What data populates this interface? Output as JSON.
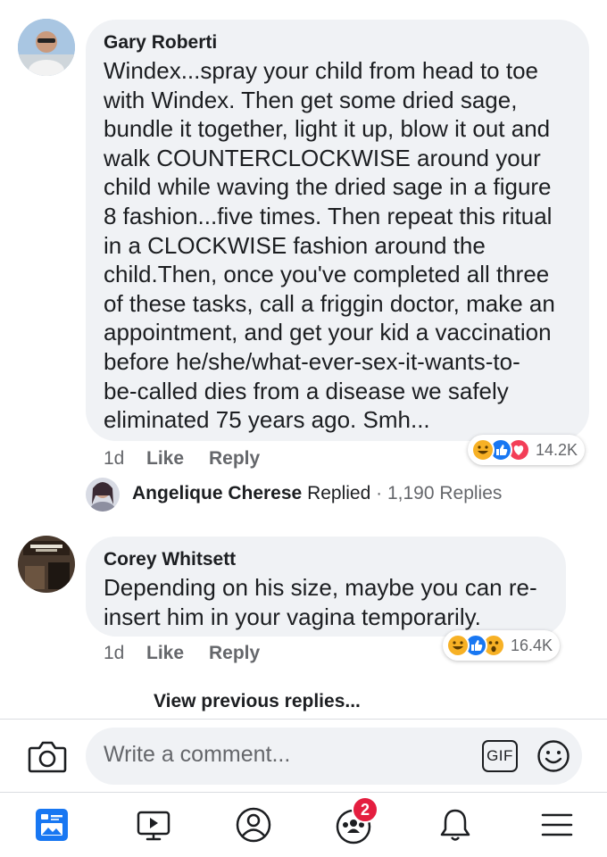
{
  "comments": [
    {
      "author": "Gary Roberti",
      "text_lines": [
        "Windex...spray your child from head to toe",
        "with Windex. Then get some dried sage,",
        "bundle it together, light it up, blow it out and",
        "walk COUNTERCLOCKWISE around your",
        "child while waving the dried sage in a figure",
        "8 fashion...five times. Then repeat this ritual",
        "in a CLOCKWISE fashion around the",
        "child.Then, once you've completed all three",
        "of these tasks, call a friggin doctor, make an",
        "appointment, and get your kid a vaccination",
        "before he/she/what-ever-sex-it-wants-to-",
        "be-called dies from a disease we safely",
        "eliminated 75 years ago. Smh..."
      ],
      "time": "1d",
      "like_label": "Like",
      "reply_label": "Reply",
      "reaction_count": "14.2K",
      "reaction_icons": [
        "haha-icon",
        "like-icon",
        "love-icon"
      ]
    },
    {
      "author": "Corey Whitsett",
      "text_lines": [
        "Depending on his size, maybe you can re-",
        "insert him in your vagina temporarily."
      ],
      "time": "1d",
      "like_label": "Like",
      "reply_label": "Reply",
      "reaction_count": "16.4K",
      "reaction_icons": [
        "haha-icon",
        "like-icon",
        "wow-icon"
      ]
    }
  ],
  "reply_summary": {
    "name": "Angelique Cherese",
    "action": "Replied",
    "separator": "·",
    "count": "1,190 Replies"
  },
  "view_previous": "View previous replies...",
  "composer": {
    "placeholder": "Write a comment...",
    "gif_label": "GIF"
  },
  "tab_bar": {
    "tabs": [
      "news-feed-icon",
      "watch-icon",
      "profile-icon",
      "groups-icon",
      "notifications-icon",
      "menu-icon"
    ],
    "groups_badge": "2"
  },
  "colors": {
    "bubble": "#f0f2f5",
    "accent": "#1877f2",
    "badge": "#e41e3f",
    "muted_text": "#65676b"
  }
}
